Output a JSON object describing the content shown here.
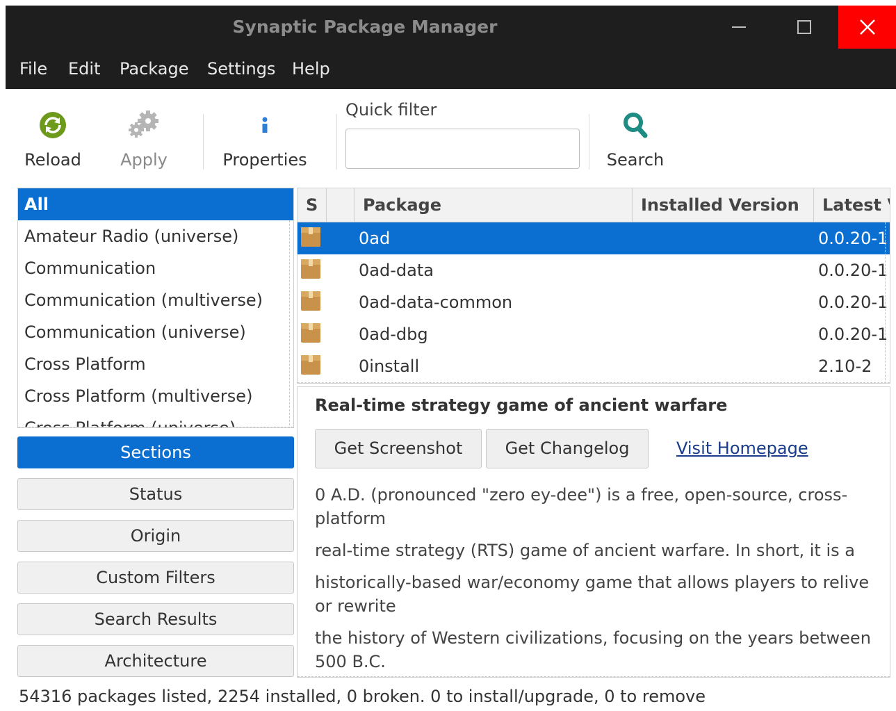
{
  "window": {
    "title": "Synaptic Package Manager"
  },
  "menubar": {
    "items": [
      "File",
      "Edit",
      "Package",
      "Settings",
      "Help"
    ]
  },
  "toolbar": {
    "reload_label": "Reload",
    "apply_label": "Apply",
    "properties_label": "Properties",
    "quick_filter_label": "Quick filter",
    "quick_filter_value": "",
    "search_label": "Search"
  },
  "sections": {
    "items": [
      "All",
      "Amateur Radio (universe)",
      "Communication",
      "Communication (multiverse)",
      "Communication (universe)",
      "Cross Platform",
      "Cross Platform (multiverse)",
      "Cross Platform (universe)"
    ],
    "selected": 0
  },
  "filter_buttons": {
    "sections": "Sections",
    "status": "Status",
    "origin": "Origin",
    "custom_filters": "Custom Filters",
    "search_results": "Search Results",
    "architecture": "Architecture"
  },
  "packages": {
    "columns": {
      "s": "S",
      "package": "Package",
      "installed": "Installed Version",
      "latest": "Latest Version"
    },
    "rows": [
      {
        "name": "0ad",
        "installed": "",
        "latest": "0.0.20-1"
      },
      {
        "name": "0ad-data",
        "installed": "",
        "latest": "0.0.20-1"
      },
      {
        "name": "0ad-data-common",
        "installed": "",
        "latest": "0.0.20-1"
      },
      {
        "name": "0ad-dbg",
        "installed": "",
        "latest": "0.0.20-1"
      },
      {
        "name": "0install",
        "installed": "",
        "latest": "2.10-2"
      }
    ],
    "selected": 0
  },
  "details": {
    "title": "Real-time strategy game of ancient warfare",
    "get_screenshot": "Get Screenshot",
    "get_changelog": "Get Changelog",
    "visit_homepage": "Visit Homepage",
    "paragraphs": [
      "0 A.D. (pronounced \"zero ey-dee\") is a free, open-source, cross-platform",
      "real-time strategy (RTS) game of ancient warfare. In short, it is a",
      "historically-based war/economy game that allows players to relive or rewrite",
      "the history of Western civilizations, focusing on the years between 500 B.C."
    ]
  },
  "status": {
    "text": "54316 packages listed, 2254 installed, 0 broken. 0 to install/upgrade, 0 to remove"
  },
  "colors": {
    "accent": "#0a6fd0",
    "titlebar": "#1e1e1e",
    "close": "#ff0000",
    "reload_icon": "#6e9a1c",
    "search_icon": "#1f8c84",
    "properties_icon": "#2d7fd6"
  }
}
